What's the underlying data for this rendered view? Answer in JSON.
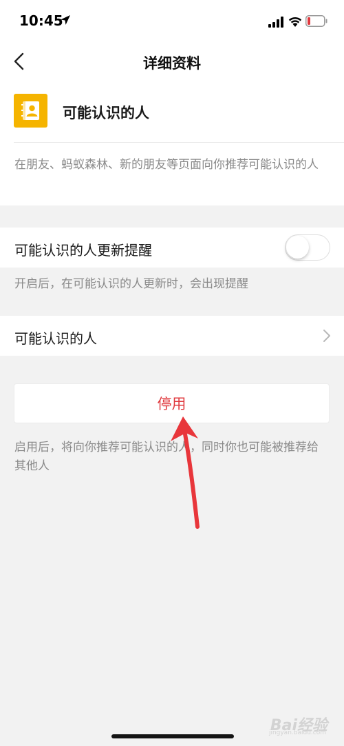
{
  "status_bar": {
    "time": "10:45",
    "icons": [
      "location-arrow-icon",
      "cellular-signal-icon",
      "wifi-icon",
      "battery-low-icon"
    ],
    "battery_color": "#e0393e"
  },
  "nav": {
    "back_icon": "chevron-left-icon",
    "title": "详细资料"
  },
  "info": {
    "icon": "contacts-book-icon",
    "icon_color": "#f5b400",
    "name": "可能认识的人",
    "description": "在朋友、蚂蚁森林、新的朋友等页面向你推荐可能认识的人"
  },
  "settings": {
    "update_reminder": {
      "label": "可能认识的人更新提醒",
      "enabled": false,
      "hint": "开启后，在可能认识的人更新时，会出现提醒"
    },
    "people_link": {
      "label": "可能认识的人",
      "icon": "chevron-right-icon"
    }
  },
  "action": {
    "disable_label": "停用",
    "label_color": "#e0393e",
    "hint": "启用后，将向你推荐可能认识的人，同时你也可能被推荐给其他人"
  },
  "annotation": {
    "icon": "red-arrow-icon",
    "color": "#e0393e"
  },
  "watermark": {
    "text": "Bai经验",
    "sub": "jingyan.baidu.com"
  }
}
